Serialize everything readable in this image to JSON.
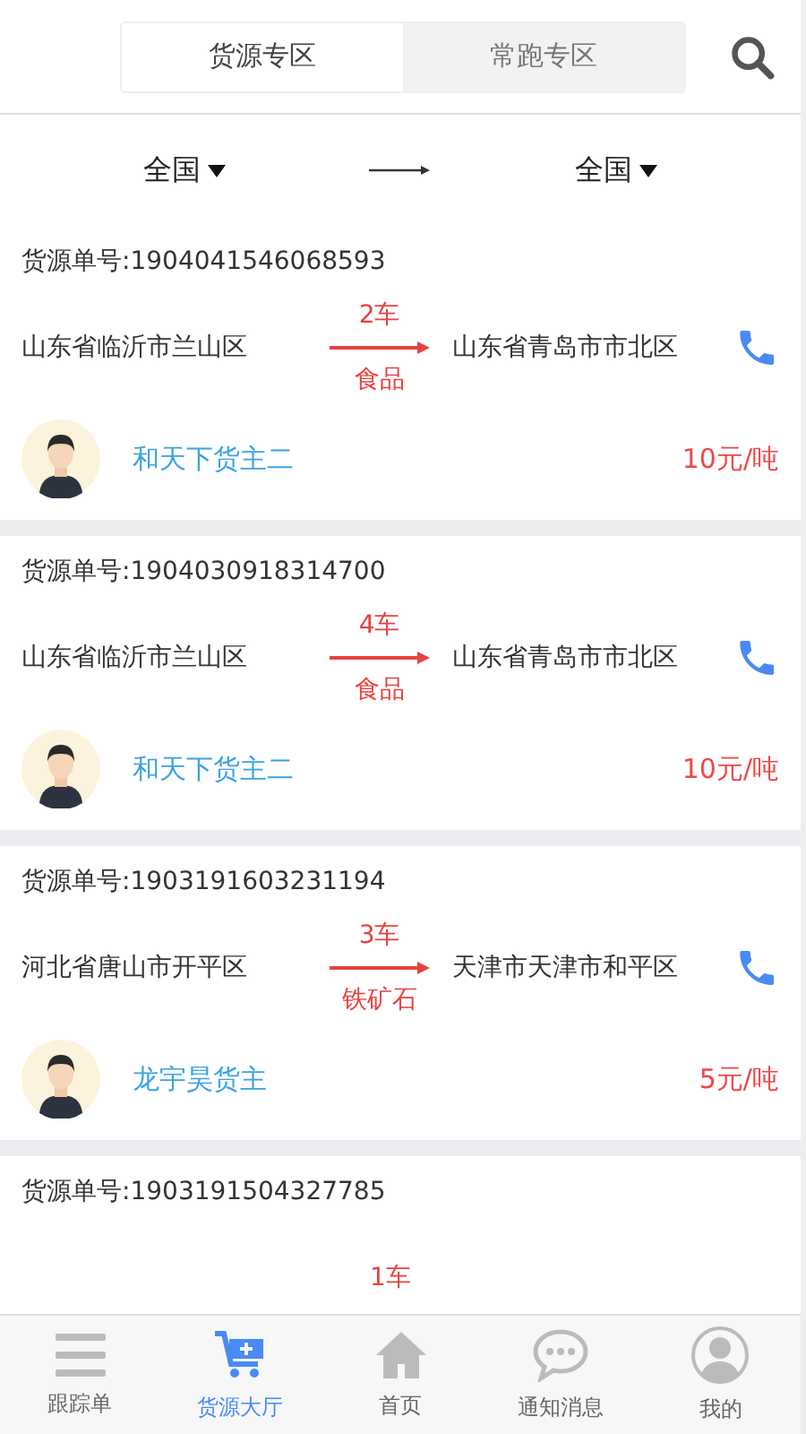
{
  "tabs": [
    {
      "label": "货源专区",
      "selected": true
    },
    {
      "label": "常跑专区",
      "selected": false
    }
  ],
  "filter": {
    "origin": "全国",
    "destination": "全国"
  },
  "cards": [
    {
      "order_no": "货源单号:1904041546068593",
      "from": "山东省临沂市兰山区",
      "vehicles": "2车",
      "goods": "食品",
      "to": "山东省青岛市市北区",
      "owner": "和天下货主二",
      "price": "10元/吨"
    },
    {
      "order_no": "货源单号:1904030918314700",
      "from": "山东省临沂市兰山区",
      "vehicles": "4车",
      "goods": "食品",
      "to": "山东省青岛市市北区",
      "owner": "和天下货主二",
      "price": "10元/吨"
    },
    {
      "order_no": "货源单号:1903191603231194",
      "from": "河北省唐山市开平区",
      "vehicles": "3车",
      "goods": "铁矿石",
      "to": "天津市天津市和平区",
      "owner": "龙宇昊货主",
      "price": "5元/吨"
    },
    {
      "order_no": "货源单号:1903191504327785",
      "vehicles": "1车"
    }
  ],
  "nav": [
    {
      "kind": "list",
      "label": "跟踪单",
      "selected": false
    },
    {
      "kind": "cart",
      "label": "货源大厅",
      "selected": true
    },
    {
      "kind": "home",
      "label": "首页",
      "selected": false
    },
    {
      "kind": "chat",
      "label": "通知消息",
      "selected": false
    },
    {
      "kind": "user",
      "label": "我的",
      "selected": false
    }
  ]
}
